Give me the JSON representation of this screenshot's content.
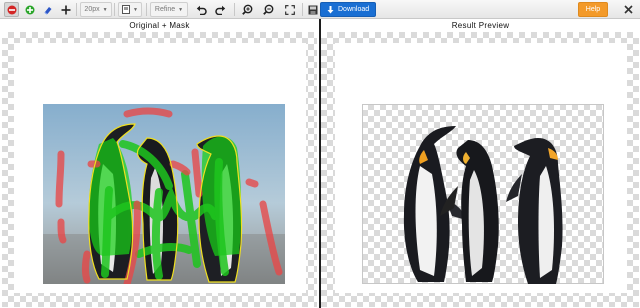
{
  "toolbar": {
    "brush_size": "20px",
    "refine_label": "Refine",
    "download_label": "Download",
    "help_label": "Help"
  },
  "panels": {
    "left_title": "Original + Mask",
    "right_title": "Result Preview"
  },
  "colors": {
    "accent_download": "#1a6fd3",
    "accent_help": "#f39a2a",
    "mask_foreground": "#20c020",
    "mask_background": "#e85050",
    "outline": "#f0e020"
  },
  "icons": [
    "remove-brush-icon",
    "keep-brush-icon",
    "eraser-icon",
    "pan-icon",
    "view-mode-icon",
    "undo-icon",
    "redo-icon",
    "zoom-in-icon",
    "zoom-out-icon",
    "fit-screen-icon",
    "save-icon",
    "download-icon"
  ]
}
